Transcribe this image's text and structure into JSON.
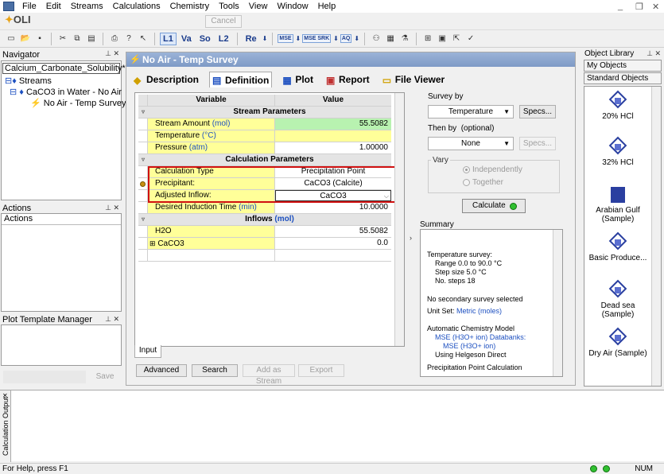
{
  "menu": [
    "File",
    "Edit",
    "Streams",
    "Calculations",
    "Chemistry",
    "Tools",
    "View",
    "Window",
    "Help"
  ],
  "window_controls": {
    "minimize": "_",
    "restore": "❐",
    "close": "✕"
  },
  "toolbar": {
    "logo": "OLI",
    "cancel_label": "Cancel",
    "text_buttons": [
      "L1",
      "Va",
      "So",
      "L2",
      "Re"
    ],
    "small_buttons": [
      "MSE",
      "MSE SRK",
      "AQ"
    ]
  },
  "navigator": {
    "title": "Navigator",
    "selector": "Calcium_Carbonate_Solubility*",
    "tree": [
      "Streams",
      "CaCO3 in Water - No Air",
      "No Air - Temp Survey"
    ]
  },
  "actions": {
    "title": "Actions",
    "header": "Actions"
  },
  "plot_template": {
    "title": "Plot Template Manager",
    "save_label": "Save"
  },
  "document": {
    "title": "No Air - Temp Survey",
    "tabs": [
      "Description",
      "Definition",
      "Plot",
      "Report",
      "File Viewer"
    ],
    "grid": {
      "col_variable": "Variable",
      "col_value": "Value",
      "stream_section": "Stream Parameters",
      "stream_rows": [
        {
          "name": "Stream Amount",
          "unit": "(mol)",
          "value": "55.5082"
        },
        {
          "name": "Temperature",
          "unit": "(°C)",
          "value": ""
        },
        {
          "name": "Pressure",
          "unit": "(atm)",
          "value": "1.00000"
        }
      ],
      "calc_section": "Calculation Parameters",
      "calc_rows": [
        {
          "name": "Calculation Type",
          "value": "Precipitation Point"
        },
        {
          "name": "Precipitant:",
          "value": "CaCO3 (Calcite)"
        },
        {
          "name": "Adjusted Inflow:",
          "value": "CaCO3"
        }
      ],
      "induction": {
        "name": "Desired Induction Time",
        "unit": "(min)",
        "value": "10.0000"
      },
      "inflows_section": "Inflows",
      "inflows_unit": "(mol)",
      "inflow_rows": [
        {
          "name": "H2O",
          "value": "55.5082"
        },
        {
          "name": "CaCO3",
          "value": "0.0"
        }
      ]
    },
    "input_tab": "Input",
    "buttons": {
      "advanced": "Advanced",
      "search": "Search",
      "add_stream": "Add as Stream",
      "export": "Export"
    },
    "survey": {
      "survey_by_label": "Survey by",
      "survey_by_value": "Temperature",
      "specs_label": "Specs...",
      "then_by_label": "Then by",
      "then_by_optional": "(optional)",
      "then_by_value": "None",
      "vary_label": "Vary",
      "vary_options": [
        "Independently",
        "Together"
      ],
      "calculate_label": "Calculate"
    },
    "summary": {
      "title": "Summary",
      "lines": [
        "Temperature survey:",
        "Range      0.0 to 90.0 °C",
        "Step size   5.0 °C",
        "No. steps   18",
        "No secondary survey selected",
        "Unit Set:",
        "Metric (moles)",
        "Automatic Chemistry Model",
        "MSE (H3O+ ion) Databanks:",
        "MSE (H3O+ ion)",
        "Using Helgeson Direct",
        "Precipitation Point Calculation"
      ]
    }
  },
  "object_library": {
    "title": "Object Library",
    "tabs": [
      "My Objects",
      "Standard Objects"
    ],
    "items": [
      "20% HCl",
      "32% HCl",
      "Arabian Gulf (Sample)",
      "Basic Produce...",
      "Dead sea (Sample)",
      "Dry Air (Sample)"
    ]
  },
  "calc_output": {
    "label": "Calculation Output"
  },
  "status": {
    "help": "For Help, press F1",
    "num": "NUM"
  }
}
